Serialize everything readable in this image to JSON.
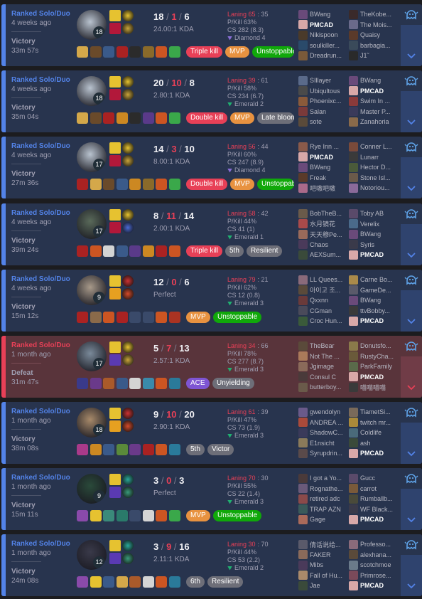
{
  "colors": {
    "win_bg": "#28344e",
    "loss_bg": "#59343b",
    "accent_blue": "#5383e8",
    "accent_red": "#e84057"
  },
  "icons": {
    "expand": "chevron-down-icon",
    "tag": "ghost-tag-icon"
  },
  "matches": [
    {
      "result_class": "win",
      "queue": "Ranked Solo/Duo",
      "ago": "4 weeks ago",
      "result": "Victory",
      "duration": "33m 57s",
      "champ_level": "18",
      "champ_color": "#b9c3cf",
      "kills": "18",
      "deaths": "1",
      "assists": "6",
      "ratio": "24.00:1 KDA",
      "laning": "Laning 65",
      "laning_opp": ": 35",
      "pkill": "P/Kill 63%",
      "cs": "CS 282 (8.3)",
      "tier": "Diamond 4",
      "tier_color": "#8a6fd6",
      "spells": [
        "#e6c230",
        "#b2183a"
      ],
      "runes": [
        "#e6c230",
        "#c9a43a"
      ],
      "items": [
        "#d4a84a",
        "#6a4a2a",
        "#3a5a8a",
        "#aa2222",
        "#2b2b2b",
        "#8a6a2a",
        "#cc5522",
        "#3aa84a"
      ],
      "badges": [
        {
          "text": "Triple kill",
          "tone": "red"
        },
        {
          "text": "MVP",
          "tone": "orange"
        },
        {
          "text": "Unstoppable",
          "tone": "green"
        }
      ],
      "players": [
        "BWang",
        "PMCAD",
        "Nikispoon",
        "soulkiller...",
        "Dreadrun...",
        "TheKobe...",
        "The Mois...",
        "Quaisy",
        "barbagia...",
        "J1˜"
      ],
      "player_colors": [
        "#6a4a7a",
        "#d8a8a8",
        "#4a3a2a",
        "#2a4a6a",
        "#7a5a3a",
        "#3a2a2a",
        "#6a6a8a",
        "#5a3a2a",
        "#3a4a5a",
        "#2a2a2a"
      ],
      "me_index": 1
    },
    {
      "result_class": "win",
      "queue": "Ranked Solo/Duo",
      "ago": "4 weeks ago",
      "result": "Victory",
      "duration": "35m 04s",
      "champ_level": "18",
      "champ_color": "#b9c3cf",
      "kills": "20",
      "deaths": "10",
      "assists": "8",
      "ratio": "2.80:1 KDA",
      "laning": "Laning 39",
      "laning_opp": ": 61",
      "pkill": "P/Kill 58%",
      "cs": "CS 234 (6.7)",
      "tier": "Emerald 2",
      "tier_color": "#20b070",
      "spells": [
        "#e6c230",
        "#b2183a"
      ],
      "runes": [
        "#e6c230",
        "#c9a43a"
      ],
      "items": [
        "#d4a84a",
        "#6a4a2a",
        "#aa2222",
        "#cc8822",
        "#2b2b2b",
        "#5a3a8a",
        "#cc5522",
        "#3aa84a"
      ],
      "badges": [
        {
          "text": "Double kill",
          "tone": "red"
        },
        {
          "text": "MVP",
          "tone": "orange"
        },
        {
          "text": "Late bloomer",
          "tone": "gray"
        }
      ],
      "players": [
        "SIllayer",
        "Ubiqultous",
        "Phoenixc...",
        "Salan",
        "sote",
        "BWang",
        "PMCAD",
        "Swim In ...",
        "Master P...",
        "Zanahoria"
      ],
      "player_colors": [
        "#5a6a8a",
        "#4a4a4a",
        "#8a5a3a",
        "#7a3a3a",
        "#5a4a3a",
        "#6a4a7a",
        "#d8a8a8",
        "#8a3a3a",
        "#3a3a5a",
        "#8a6a4a"
      ],
      "me_index": 6
    },
    {
      "result_class": "win",
      "queue": "Ranked Solo/Duo",
      "ago": "4 weeks ago",
      "result": "Victory",
      "duration": "27m 36s",
      "champ_level": "17",
      "champ_color": "#b9c3cf",
      "kills": "14",
      "deaths": "3",
      "assists": "10",
      "ratio": "8.00:1 KDA",
      "laning": "Laning 56",
      "laning_opp": ": 44",
      "pkill": "P/Kill 60%",
      "cs": "CS 247 (8.9)",
      "tier": "Diamond 4",
      "tier_color": "#8a6fd6",
      "spells": [
        "#e6c230",
        "#b2183a"
      ],
      "runes": [
        "#e6c230",
        "#c9a43a"
      ],
      "items": [
        "#aa2222",
        "#d4a84a",
        "#6a4a2a",
        "#3a5a8a",
        "#cc8822",
        "#8a6a2a",
        "#cc5522",
        "#3aa84a"
      ],
      "badges": [
        {
          "text": "Double kill",
          "tone": "red"
        },
        {
          "text": "MVP",
          "tone": "orange"
        },
        {
          "text": "Unstoppable",
          "tone": "green"
        }
      ],
      "players": [
        "Rye Inn ...",
        "PMCAD",
        "BWang",
        "Freak",
        "吧嗷吧嗷",
        "Conner L...",
        "Lunarr",
        "Hector D...",
        "Stone Isl...",
        "Notoriou..."
      ],
      "player_colors": [
        "#8a5a4a",
        "#d8a8a8",
        "#6a4a7a",
        "#5a3a2a",
        "#aa6a8a",
        "#7a4a3a",
        "#3a3a3a",
        "#4a5a3a",
        "#6a5a4a",
        "#8a6a9a"
      ],
      "me_index": 1
    },
    {
      "result_class": "win",
      "queue": "Ranked Solo/Duo",
      "ago": "4 weeks ago",
      "result": "Victory",
      "duration": "39m 24s",
      "champ_level": "17",
      "champ_color": "#5a6a5a",
      "kills": "8",
      "deaths": "11",
      "assists": "14",
      "ratio": "2.00:1 KDA",
      "laning": "Laning 58",
      "laning_opp": ": 42",
      "pkill": "P/Kill 44%",
      "cs": "CS 41 (1)",
      "tier": "Emerald 1",
      "tier_color": "#20b070",
      "spells": [
        "#e6c230",
        "#b2183a"
      ],
      "runes": [
        "#e6c230",
        "#4a6ad6"
      ],
      "items": [
        "#aa2222",
        "#cc5522",
        "#d4d4d4",
        "#3a5a8a",
        "#5a3a8a",
        "#cc8822",
        "#aa2222",
        "#cc5522"
      ],
      "badges": [
        {
          "text": "Triple kill",
          "tone": "red"
        },
        {
          "text": "5th",
          "tone": "gray"
        },
        {
          "text": "Resilient",
          "tone": "gray"
        }
      ],
      "players": [
        "BobTheB...",
        "水月镜花",
        "天天穆Pe...",
        "Chaos",
        "AEXSum...",
        "Toby AB",
        "Verelix",
        "BWang",
        "Syris",
        "PMCAD"
      ],
      "player_colors": [
        "#6a5a4a",
        "#aa4a4a",
        "#9a6a5a",
        "#4a3a5a",
        "#3a4a3a",
        "#5a4a6a",
        "#4a6a8a",
        "#6a4a7a",
        "#3a3a4a",
        "#d8a8a8"
      ],
      "me_index": 9
    },
    {
      "result_class": "win",
      "queue": "Ranked Solo/Duo",
      "ago": "4 weeks ago",
      "result": "Victory",
      "duration": "15m 12s",
      "champ_level": "9",
      "champ_color": "#a89a8a",
      "kills": "12",
      "deaths": "0",
      "assists": "6",
      "ratio": "Perfect",
      "laning": "Laning 79",
      "laning_opp": ": 21",
      "pkill": "P/Kill 62%",
      "cs": "CS 12 (0.8)",
      "tier": "Emerald 3",
      "tier_color": "#20b070",
      "spells": [
        "#e6c230",
        "#e6a020"
      ],
      "runes": [
        "#cc3333",
        "#d44a2a"
      ],
      "items": [
        "#aa2222",
        "#8a6a4a",
        "#cc5522",
        "#aa2222",
        "empty",
        "empty",
        "#cc5522",
        "#aa3322"
      ],
      "badges": [
        {
          "text": "MVP",
          "tone": "orange"
        },
        {
          "text": "Unstoppable",
          "tone": "green"
        }
      ],
      "players": [
        "LL Quees...",
        "아이고 조...",
        "Qxxnn",
        "CGman",
        "Croc Hun...",
        "Carne Bo...",
        "GameDe...",
        "BWang",
        "ttvBobby...",
        "PMCAD"
      ],
      "player_colors": [
        "#8a6a7a",
        "#5a4a3a",
        "#6a3a3a",
        "#4a4a5a",
        "#3a5a3a",
        "#aa8a4a",
        "#5a5a6a",
        "#6a4a7a",
        "#3a3a3a",
        "#d8a8a8"
      ],
      "me_index": 9
    },
    {
      "result_class": "loss",
      "queue": "Ranked Solo/Duo",
      "ago": "1 month ago",
      "result": "Defeat",
      "duration": "31m 47s",
      "champ_level": "17",
      "champ_color": "#7a8a9a",
      "kills": "5",
      "deaths": "7",
      "assists": "13",
      "ratio": "2.57:1 KDA",
      "laning": "Laning 34",
      "laning_opp": ": 66",
      "pkill": "P/Kill 78%",
      "cs": "CS 277 (8.7)",
      "tier": "Emerald 3",
      "tier_color": "#20b070",
      "spells": [
        "#e6c230",
        "#5a3ab2"
      ],
      "runes": [
        "#e6c230",
        "#c9a43a"
      ],
      "items": [
        "#3a3a8a",
        "#6a3a8a",
        "#aa5a2a",
        "#3a5a8a",
        "#d4d4d4",
        "#3a8aaa",
        "#cc5522",
        "#2a7a9a"
      ],
      "badges": [
        {
          "text": "ACE",
          "tone": "purple"
        },
        {
          "text": "Unyielding",
          "tone": "gray"
        }
      ],
      "players": [
        "TheBear",
        "Not The ...",
        "Jgimage",
        "Consul C",
        "butterboy...",
        "Donutsfo...",
        "RustyCha...",
        "ParkFamily",
        "PMCAD",
        "喵喵喵喵"
      ],
      "player_colors": [
        "#5a4a3a",
        "#aa7a5a",
        "#8a6a5a",
        "#4a3a3a",
        "#6a5a4a",
        "#8a7a4a",
        "#6a5a3a",
        "#5a6a4a",
        "#d8a8a8",
        "#3a3a3a"
      ],
      "me_index": 8
    },
    {
      "result_class": "win",
      "queue": "Ranked Solo/Duo",
      "ago": "1 month ago",
      "result": "Victory",
      "duration": "38m 08s",
      "champ_level": "18",
      "champ_color": "#a88a6a",
      "kills": "9",
      "deaths": "10",
      "assists": "20",
      "ratio": "2.90:1 KDA",
      "laning": "Laning 61",
      "laning_opp": ": 39",
      "pkill": "P/Kill 47%",
      "cs": "CS 73 (1.9)",
      "tier": "Emerald 3",
      "tier_color": "#20b070",
      "spells": [
        "#e6c230",
        "#e6a020"
      ],
      "runes": [
        "#cc3333",
        "#d44a2a"
      ],
      "items": [
        "#aa3a8a",
        "#cc8822",
        "#3a5a8a",
        "#5a8a3a",
        "#6a3a8a",
        "#aa2222",
        "#cc5522",
        "#2a7a9a"
      ],
      "badges": [
        {
          "text": "5th",
          "tone": "gray"
        },
        {
          "text": "Victor",
          "tone": "gray"
        }
      ],
      "players": [
        "gwendolyn",
        "ANDREA ...",
        "ShadowC...",
        "E1nsicht",
        "Syrupdrin...",
        "TiametSi...",
        "twitch mr...",
        "Coldlife",
        "ash",
        "PMCAD"
      ],
      "player_colors": [
        "#6a5a8a",
        "#aa4a3a",
        "#3a3a5a",
        "#8a7a5a",
        "#5a4a4a",
        "#7a6a5a",
        "#aa8a3a",
        "#4a6a7a",
        "#3a4a3a",
        "#d8a8a8"
      ],
      "me_index": 9
    },
    {
      "result_class": "win",
      "queue": "Ranked Solo/Duo",
      "ago": "1 month ago",
      "result": "Victory",
      "duration": "15m 11s",
      "champ_level": "9",
      "champ_color": "#2a4a3a",
      "kills": "3",
      "deaths": "0",
      "assists": "3",
      "ratio": "Perfect",
      "laning": "Laning 70",
      "laning_opp": ": 30",
      "pkill": "P/Kill 55%",
      "cs": "CS 22 (1.4)",
      "tier": "Emerald 3",
      "tier_color": "#20b070",
      "spells": [
        "#e6c230",
        "#5a3ab2"
      ],
      "runes": [
        "#2aa89a",
        "#3a9a7a"
      ],
      "items": [
        "#8a4aaa",
        "#e6c230",
        "#3a8a7a",
        "#2a7a6a",
        "empty",
        "#d4d4d4",
        "#cc5522",
        "#3aa84a"
      ],
      "badges": [
        {
          "text": "MVP",
          "tone": "orange"
        },
        {
          "text": "Unstoppable",
          "tone": "green"
        }
      ],
      "players": [
        "I got a Yo...",
        "Rognathe...",
        "retired adc",
        "TRAP AZN",
        "Gage",
        "Gucc",
        "carrot",
        "Rumballb...",
        "WF Black...",
        "PMCAD"
      ],
      "player_colors": [
        "#4a3a3a",
        "#6a5a7a",
        "#8a4a4a",
        "#3a5a5a",
        "#aa6a5a",
        "#5a4a6a",
        "#7a5a3a",
        "#4a4a3a",
        "#3a3a4a",
        "#d8a8a8"
      ],
      "me_index": 9
    },
    {
      "result_class": "win",
      "queue": "Ranked Solo/Duo",
      "ago": "1 month ago",
      "result": "Victory",
      "duration": "24m 08s",
      "champ_level": "12",
      "champ_color": "#3a3a4a",
      "kills": "3",
      "deaths": "9",
      "assists": "16",
      "ratio": "2.11:1 KDA",
      "laning": "Laning 30",
      "laning_opp": ": 70",
      "pkill": "P/Kill 44%",
      "cs": "CS 53 (2.2)",
      "tier": "Emerald 2",
      "tier_color": "#20b070",
      "spells": [
        "#e6c230",
        "#5a3ab2"
      ],
      "runes": [
        "#2aa89a",
        "#3a9a7a"
      ],
      "items": [
        "#8a4aaa",
        "#e6c230",
        "#3a5a8a",
        "#d4a84a",
        "#aa5a2a",
        "#d4d4d4",
        "#cc5522",
        "#2a7a9a"
      ],
      "badges": [
        {
          "text": "6th",
          "tone": "gray"
        },
        {
          "text": "Resilient",
          "tone": "gray"
        }
      ],
      "players": [
        "倩话说给...",
        "FAKER",
        "Mibs",
        "Fall of Hu...",
        "Jae",
        "Professo...",
        "alexhana...",
        "scotchmoe",
        "Primrose...",
        "PMCAD"
      ],
      "player_colors": [
        "#5a5a6a",
        "#8a6a5a",
        "#4a3a5a",
        "#aa8a6a",
        "#3a4a3a",
        "#8a6a7a",
        "#5a4a3a",
        "#6a7a8a",
        "#7a4a5a",
        "#d8a8a8"
      ],
      "me_index": 9
    }
  ]
}
